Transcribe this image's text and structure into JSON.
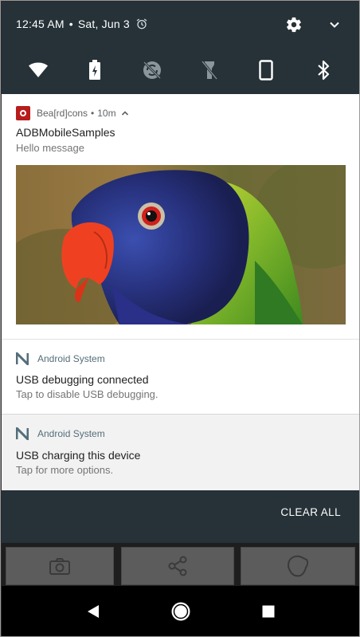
{
  "status_bar": {
    "time": "12:45 AM",
    "separator": "•",
    "date": "Sat, Jun 3"
  },
  "quick_settings": {
    "tiles": [
      "wifi-icon",
      "battery-saver-icon",
      "sync-disabled-icon",
      "flashlight-off-icon",
      "portrait-rotation-icon",
      "bluetooth-icon"
    ]
  },
  "notifications": [
    {
      "app_name": "Bea[rd]cons",
      "separator": "•",
      "time": "10m",
      "title": "ADBMobileSamples",
      "text": "Hello message",
      "image": "parrot-photo"
    },
    {
      "app_name": "Android System",
      "title": "USB debugging connected",
      "text": "Tap to disable USB debugging."
    },
    {
      "app_name": "Android System",
      "title": "USB charging this device",
      "text": "Tap for more options."
    }
  ],
  "actions": {
    "clear_all": "CLEAR ALL"
  },
  "colors": {
    "panel": "#263238",
    "notification_bg": "#ffffff",
    "secondary_text": "#757575"
  }
}
